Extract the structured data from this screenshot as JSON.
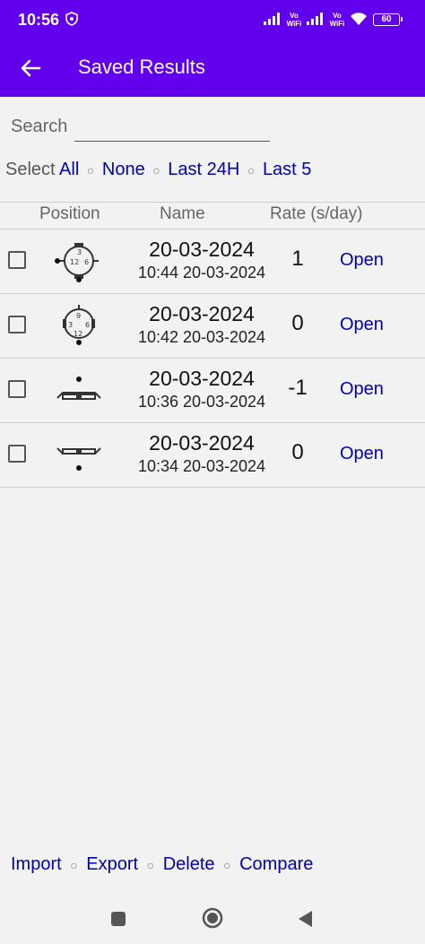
{
  "status_bar": {
    "time": "10:56",
    "volte1": "Vo\nWiFi",
    "volte2": "Vo\nWiFi",
    "battery": "60"
  },
  "app_bar": {
    "title": "Saved Results"
  },
  "search": {
    "label": "Search",
    "value": ""
  },
  "select": {
    "prefix": "Select",
    "options": [
      "All",
      "None",
      "Last 24H",
      "Last 5"
    ],
    "separator": "○"
  },
  "table": {
    "headers": [
      "Position",
      "Name",
      "Rate (s/day)"
    ],
    "rows": [
      {
        "position_icon": "watch-crown-left-icon",
        "name": "20-03-2024",
        "datetime": "10:44 20-03-2024",
        "rate": "1",
        "action": "Open"
      },
      {
        "position_icon": "watch-crown-down-icon",
        "name": "20-03-2024",
        "datetime": "10:42 20-03-2024",
        "rate": "0",
        "action": "Open"
      },
      {
        "position_icon": "watch-dial-up-icon",
        "name": "20-03-2024",
        "datetime": "10:36 20-03-2024",
        "rate": "-1",
        "action": "Open"
      },
      {
        "position_icon": "watch-dial-down-icon",
        "name": "20-03-2024",
        "datetime": "10:34 20-03-2024",
        "rate": "0",
        "action": "Open"
      }
    ]
  },
  "actions": {
    "items": [
      "Import",
      "Export",
      "Delete",
      "Compare"
    ],
    "separator": "○"
  },
  "nav": {
    "icons": [
      "recents-square-icon",
      "home-circle-icon",
      "back-triangle-icon"
    ]
  },
  "colors": {
    "accent": "#6200ee",
    "link": "#0000b8",
    "background": "#f2f2f2"
  }
}
